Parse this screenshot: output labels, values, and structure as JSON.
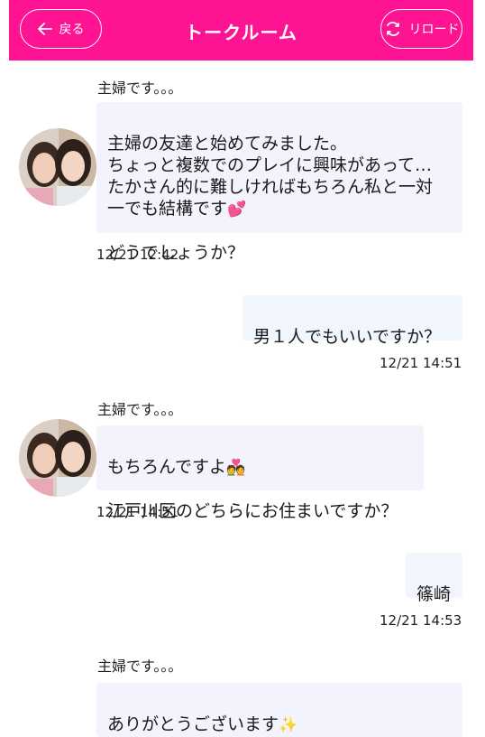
{
  "header": {
    "back_label": "戻る",
    "title": "トークルーム",
    "reload_label": "リロード"
  },
  "messages": [
    {
      "sender": "主婦です。。。",
      "text": "主婦の友達と始めてみました。\nちょっと複数でのプレイに興味があって…\nたかさん的に難しければもちろん私と一対\n一でも結構です",
      "text2": "どうでしょうか？",
      "emoji": "💕",
      "time": "12/21 12:42"
    },
    {
      "text": "男１人でもいいですか？",
      "time": "12/21 14:51"
    },
    {
      "sender": "主婦です。。。",
      "text": "もちろんですよ",
      "emoji": "💑",
      "text2": "江戸川区のどちらにお住まいですか？",
      "time": "12/21 14:51"
    },
    {
      "text": "篠崎",
      "time": "12/21 14:53"
    },
    {
      "sender": "主婦です。。。",
      "text": "ありがとうございます",
      "emoji": "✨"
    }
  ]
}
